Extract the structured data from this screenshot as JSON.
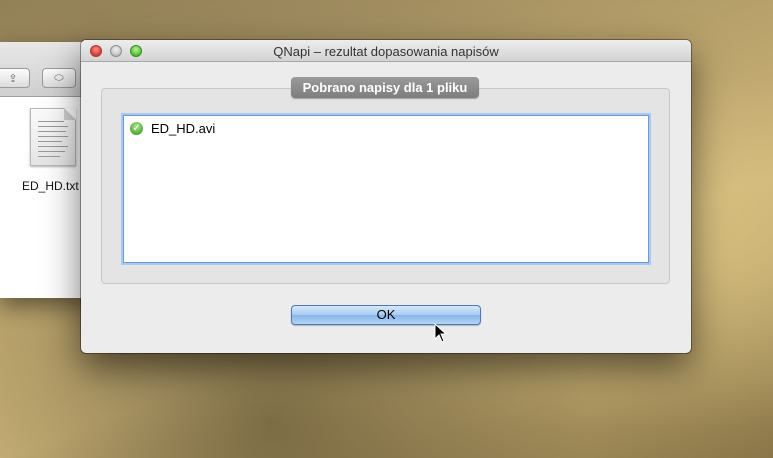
{
  "finder": {
    "file_label": "ED_HD.txt"
  },
  "dialog": {
    "title": "QNapi – rezultat dopasowania napisów",
    "group_title": "Pobrano napisy dla 1 pliku",
    "items": [
      {
        "label": "ED_HD.avi",
        "status_icon": "check-icon"
      }
    ],
    "ok_label": "OK"
  },
  "colors": {
    "accent": "#86b5ea",
    "close": "#e0443a",
    "zoom": "#5ec83b"
  }
}
